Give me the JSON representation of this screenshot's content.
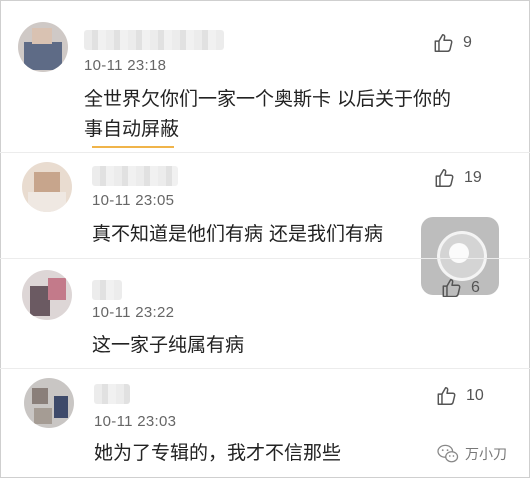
{
  "comments": [
    {
      "time": "10-11 23:18",
      "text_line1": "全世界欠你们一家一个奥斯卡 以后关于你的",
      "text_line2": "事自动屏蔽",
      "likes": "9"
    },
    {
      "time": "10-11 23:05",
      "text_line1": "真不知道是他们有病 还是我们有病",
      "likes": "19"
    },
    {
      "time": "10-11 23:22",
      "text_line1": "这一家子纯属有病",
      "likes": "6"
    },
    {
      "time": "10-11 23:03",
      "text_line1": "她为了专辑的，我才不信那些",
      "likes": "10"
    }
  ],
  "watermark": {
    "text": "万小刀"
  },
  "colors": {
    "accent_underline": "#f0b44a",
    "text": "#222222",
    "time": "#666666",
    "like_icon": "#555555"
  }
}
